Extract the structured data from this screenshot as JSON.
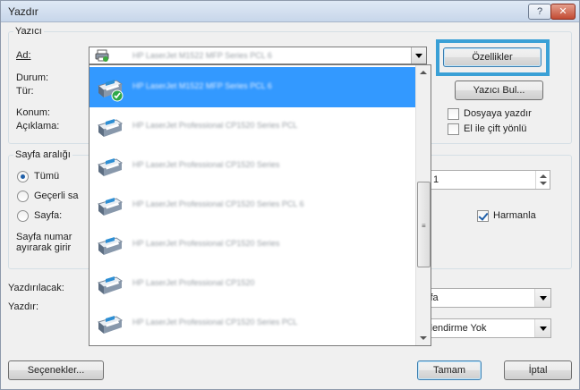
{
  "window": {
    "title": "Yazdır",
    "help_label": "?",
    "close_label": "✕"
  },
  "printer_group": {
    "legend": "Yazıcı",
    "name_label": "Ad:",
    "status_label": "Durum:",
    "type_label": "Tür:",
    "location_label": "Konum:",
    "comment_label": "Açıklama:",
    "properties_button": "Özellikler",
    "find_printer_button": "Yazıcı Bul...",
    "print_to_file_label": "Dosyaya yazdır",
    "print_to_file_checked": false,
    "manual_duplex_label": "El ile çift yönlü",
    "manual_duplex_checked": false
  },
  "page_range": {
    "legend": "Sayfa aralığı",
    "all_label": "Tümü",
    "current_label": "Geçerli sa",
    "pages_label": "Sayfa:",
    "hint_line1": "Sayfa numar",
    "hint_line2": "ayırarak girir",
    "selected": "all"
  },
  "copies": {
    "value": "1",
    "collate_label": "Harmanla",
    "collate_checked": true
  },
  "print_what_label": "Yazdırılacak:",
  "print_label": "Yazdır:",
  "print_option_value": "yfa",
  "scaling_value": "klendirme Yok",
  "footer": {
    "options_button": "Seçenekler...",
    "ok_button": "Tamam",
    "cancel_button": "İptal"
  },
  "printer_list": [
    {
      "name": "HP LaserJet M1522 MFP Series PCL 6",
      "icon": "printer-icon",
      "selected": false,
      "small": true
    },
    {
      "name": "HP LaserJet M1522 MFP Series PCL 6",
      "icon": "printer-default-check-icon",
      "selected": true
    },
    {
      "name": "HP LaserJet Professional CP1520 Series PCL",
      "icon": "printer-icon",
      "selected": false
    },
    {
      "name": "HP LaserJet Professional CP1520 Series",
      "icon": "printer-icon",
      "selected": false
    },
    {
      "name": "HP LaserJet Professional CP1520 Series PCL 6",
      "icon": "printer-icon",
      "selected": false
    },
    {
      "name": "HP LaserJet Professional CP1520 Series",
      "icon": "printer-icon",
      "selected": false
    },
    {
      "name": "HP LaserJet Professional CP1520",
      "icon": "printer-icon",
      "selected": false
    },
    {
      "name": "HP LaserJet Professional CP1520 Series PCL",
      "icon": "printer-icon",
      "selected": false
    }
  ],
  "colors": {
    "highlight": "#3aa0d6",
    "selection": "#3399ff"
  }
}
